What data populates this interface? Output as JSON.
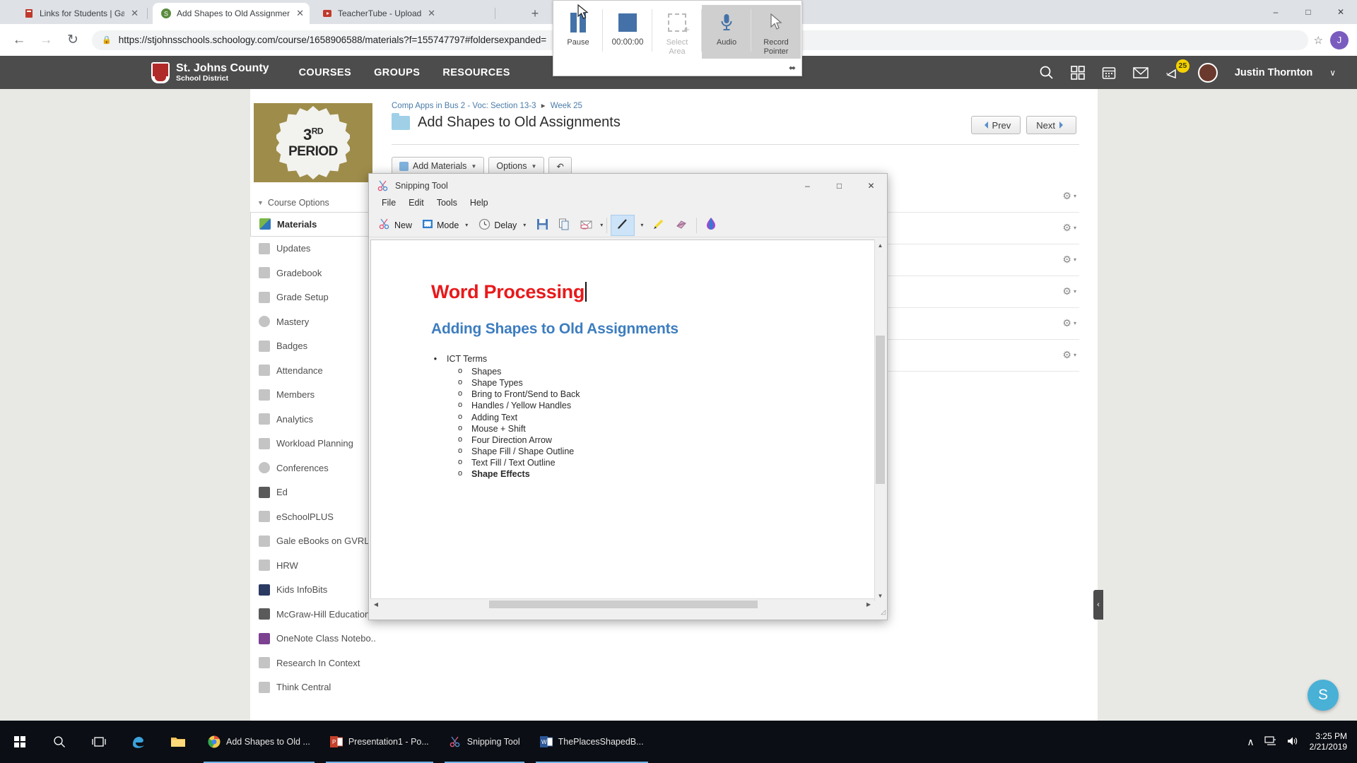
{
  "browser": {
    "tabs": [
      {
        "title": "Links for Students | Gamble Rog",
        "favicon": "book-icon",
        "active": false
      },
      {
        "title": "Add Shapes to Old Assignments",
        "favicon": "schoology-icon",
        "active": true
      },
      {
        "title": "TeacherTube - Upload",
        "favicon": "teachertube-icon",
        "active": false
      }
    ],
    "new_tab_label": "+",
    "close_label": "✕",
    "window_buttons": {
      "minimize": "–",
      "maximize": "□",
      "close": "✕"
    },
    "nav": {
      "back": "←",
      "forward": "→",
      "reload": "↻"
    },
    "address": "https://stjohnsschools.schoology.com/course/1658906588/materials?f=155747797#foldersexpanded=",
    "lock_icon": "lock-icon",
    "star_icon": "star-icon",
    "profile_initial": "J"
  },
  "recorder": {
    "pause_label": "Pause",
    "timer": "00:00:00",
    "select_area_label": "Select\nArea",
    "select_area_line1": "Select",
    "select_area_line2": "Area",
    "audio_label": "Audio",
    "record_pointer_line1": "Record",
    "record_pointer_line2": "Pointer",
    "close_label": "✕",
    "pin_label": "⬌",
    "accent_color": "#4472a8"
  },
  "schoology": {
    "district_line1": "St. Johns County",
    "district_line2": "School District",
    "nav": [
      "COURSES",
      "GROUPS",
      "RESOURCES"
    ],
    "icons": [
      "search-icon",
      "apps-grid-icon",
      "calendar-icon",
      "mail-icon",
      "notifications-icon"
    ],
    "notification_count": "25",
    "user_name": "Justin Thornton",
    "user_caret": "∨",
    "period_badge": {
      "number": "3",
      "ordinal": "RD",
      "label": "PERIOD",
      "bg_color": "#9e8c4a"
    },
    "course_options_label": "Course Options",
    "sidebar": [
      {
        "label": "Materials",
        "icon": "materials-icon",
        "selected": true
      },
      {
        "label": "Updates",
        "icon": "updates-icon",
        "selected": false
      },
      {
        "label": "Gradebook",
        "icon": "gradebook-icon",
        "selected": false
      },
      {
        "label": "Grade Setup",
        "icon": "grade-setup-icon",
        "selected": false
      },
      {
        "label": "Mastery",
        "icon": "mastery-icon",
        "selected": false
      },
      {
        "label": "Badges",
        "icon": "badges-icon",
        "selected": false
      },
      {
        "label": "Attendance",
        "icon": "attendance-icon",
        "selected": false
      },
      {
        "label": "Members",
        "icon": "members-icon",
        "selected": false
      },
      {
        "label": "Analytics",
        "icon": "analytics-icon",
        "selected": false
      },
      {
        "label": "Workload Planning",
        "icon": "workload-icon",
        "selected": false
      },
      {
        "label": "Conferences",
        "icon": "conferences-icon",
        "selected": false
      },
      {
        "label": "Ed",
        "icon": "ed-icon",
        "selected": false
      },
      {
        "label": "eSchoolPLUS",
        "icon": "eschoolplus-icon",
        "selected": false
      },
      {
        "label": "Gale eBooks on GVRL",
        "icon": "gale-icon",
        "selected": false
      },
      {
        "label": "HRW",
        "icon": "hrw-icon",
        "selected": false
      },
      {
        "label": "Kids InfoBits",
        "icon": "kids-infobits-icon",
        "selected": false
      },
      {
        "label": "McGraw-Hill Education...",
        "icon": "mcgraw-hill-icon",
        "selected": false
      },
      {
        "label": "OneNote Class Notebo...",
        "icon": "onenote-icon",
        "selected": false
      },
      {
        "label": "Research In Context",
        "icon": "research-context-icon",
        "selected": false
      },
      {
        "label": "Think Central",
        "icon": "think-central-icon",
        "selected": false
      }
    ],
    "breadcrumb": {
      "course": "Comp Apps in Bus 2 - Voc: Section 13-3",
      "separator": "▸",
      "week": "Week 25"
    },
    "page_title": "Add Shapes to Old Assignments",
    "prev_label": "Prev",
    "next_label": "Next",
    "add_materials_label": "Add Materials",
    "options_label": "Options",
    "undo_label": "↶",
    "gear_label": "⚙",
    "gear_caret": "▾",
    "material_rows": 6,
    "collapse_label": "‹",
    "support_bubble": "S"
  },
  "snipping_tool": {
    "title": "Snipping Tool",
    "window_buttons": {
      "minimize": "–",
      "maximize": "□",
      "close": "✕"
    },
    "menu": [
      "File",
      "Edit",
      "Tools",
      "Help"
    ],
    "toolbar": {
      "new_label": "New",
      "mode_label": "Mode",
      "delay_label": "Delay",
      "save_icon": "save-icon",
      "copy_icon": "copy-icon",
      "email_icon": "email-icon",
      "pen_icon": "pen-icon",
      "highlighter_icon": "highlighter-icon",
      "eraser_icon": "eraser-icon",
      "paint3d_icon": "paint-3d-icon",
      "caret": "▾"
    },
    "document": {
      "heading1": "Word Processing",
      "heading1_color": "#e8191b",
      "heading2": "Adding Shapes to Old Assignments",
      "heading2_color": "#3d7dbf",
      "list_bullet": "•",
      "list_title": "ICT Terms",
      "sub_bullet": "o",
      "sub_items": [
        {
          "text": "Shapes",
          "bold": false
        },
        {
          "text": "Shape Types",
          "bold": false
        },
        {
          "text": "Bring to Front/Send to Back",
          "bold": false
        },
        {
          "text": "Handles / Yellow Handles",
          "bold": false
        },
        {
          "text": "Adding Text",
          "bold": false
        },
        {
          "text": "Mouse + Shift",
          "bold": false
        },
        {
          "text": "Four Direction Arrow",
          "bold": false
        },
        {
          "text": "Shape Fill / Shape Outline",
          "bold": false
        },
        {
          "text": "Text Fill / Text Outline",
          "bold": false
        },
        {
          "text": "Shape Effects",
          "bold": true
        }
      ]
    }
  },
  "taskbar": {
    "start_icon": "windows-start-icon",
    "search_icon": "search-icon",
    "taskview_icon": "task-view-icon",
    "pinned": [
      {
        "name": "edge-icon",
        "color": "#4aa3df"
      },
      {
        "name": "file-explorer-icon",
        "color": "#f3c45a"
      }
    ],
    "apps": [
      {
        "label": "Add Shapes to Old ...",
        "icon": "chrome-icon"
      },
      {
        "label": "Presentation1 - Po...",
        "icon": "powerpoint-icon"
      },
      {
        "label": "Snipping Tool",
        "icon": "snipping-tool-icon"
      },
      {
        "label": "ThePlacesShapedB...",
        "icon": "word-icon"
      }
    ],
    "tray": {
      "chevron": "∧",
      "network_icon": "network-icon",
      "volume_icon": "volume-icon"
    },
    "time": "3:25 PM",
    "date": "2/21/2019"
  }
}
